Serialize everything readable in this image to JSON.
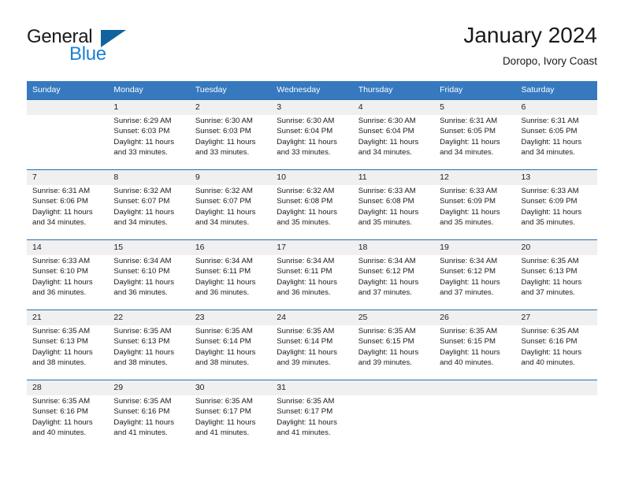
{
  "brand": {
    "name_part1": "General",
    "name_part2": "Blue",
    "flag_icon": "triangle-flag-icon"
  },
  "header": {
    "title": "January 2024",
    "subtitle": "Doropo, Ivory Coast"
  },
  "colors": {
    "header_blue": "#3679bf",
    "row_divider_blue": "#2c6ca8",
    "day_band_gray": "#f0f0f0",
    "brand_blue": "#1c7fd4",
    "flag_blue": "#11639f"
  },
  "weekday_headers": [
    "Sunday",
    "Monday",
    "Tuesday",
    "Wednesday",
    "Thursday",
    "Friday",
    "Saturday"
  ],
  "weeks": [
    {
      "days": [
        {
          "num": "",
          "lines": [
            "",
            "",
            "",
            ""
          ]
        },
        {
          "num": "1",
          "lines": [
            "Sunrise: 6:29 AM",
            "Sunset: 6:03 PM",
            "Daylight: 11 hours",
            "and 33 minutes."
          ]
        },
        {
          "num": "2",
          "lines": [
            "Sunrise: 6:30 AM",
            "Sunset: 6:03 PM",
            "Daylight: 11 hours",
            "and 33 minutes."
          ]
        },
        {
          "num": "3",
          "lines": [
            "Sunrise: 6:30 AM",
            "Sunset: 6:04 PM",
            "Daylight: 11 hours",
            "and 33 minutes."
          ]
        },
        {
          "num": "4",
          "lines": [
            "Sunrise: 6:30 AM",
            "Sunset: 6:04 PM",
            "Daylight: 11 hours",
            "and 34 minutes."
          ]
        },
        {
          "num": "5",
          "lines": [
            "Sunrise: 6:31 AM",
            "Sunset: 6:05 PM",
            "Daylight: 11 hours",
            "and 34 minutes."
          ]
        },
        {
          "num": "6",
          "lines": [
            "Sunrise: 6:31 AM",
            "Sunset: 6:05 PM",
            "Daylight: 11 hours",
            "and 34 minutes."
          ]
        }
      ]
    },
    {
      "days": [
        {
          "num": "7",
          "lines": [
            "Sunrise: 6:31 AM",
            "Sunset: 6:06 PM",
            "Daylight: 11 hours",
            "and 34 minutes."
          ]
        },
        {
          "num": "8",
          "lines": [
            "Sunrise: 6:32 AM",
            "Sunset: 6:07 PM",
            "Daylight: 11 hours",
            "and 34 minutes."
          ]
        },
        {
          "num": "9",
          "lines": [
            "Sunrise: 6:32 AM",
            "Sunset: 6:07 PM",
            "Daylight: 11 hours",
            "and 34 minutes."
          ]
        },
        {
          "num": "10",
          "lines": [
            "Sunrise: 6:32 AM",
            "Sunset: 6:08 PM",
            "Daylight: 11 hours",
            "and 35 minutes."
          ]
        },
        {
          "num": "11",
          "lines": [
            "Sunrise: 6:33 AM",
            "Sunset: 6:08 PM",
            "Daylight: 11 hours",
            "and 35 minutes."
          ]
        },
        {
          "num": "12",
          "lines": [
            "Sunrise: 6:33 AM",
            "Sunset: 6:09 PM",
            "Daylight: 11 hours",
            "and 35 minutes."
          ]
        },
        {
          "num": "13",
          "lines": [
            "Sunrise: 6:33 AM",
            "Sunset: 6:09 PM",
            "Daylight: 11 hours",
            "and 35 minutes."
          ]
        }
      ]
    },
    {
      "days": [
        {
          "num": "14",
          "lines": [
            "Sunrise: 6:33 AM",
            "Sunset: 6:10 PM",
            "Daylight: 11 hours",
            "and 36 minutes."
          ]
        },
        {
          "num": "15",
          "lines": [
            "Sunrise: 6:34 AM",
            "Sunset: 6:10 PM",
            "Daylight: 11 hours",
            "and 36 minutes."
          ]
        },
        {
          "num": "16",
          "lines": [
            "Sunrise: 6:34 AM",
            "Sunset: 6:11 PM",
            "Daylight: 11 hours",
            "and 36 minutes."
          ]
        },
        {
          "num": "17",
          "lines": [
            "Sunrise: 6:34 AM",
            "Sunset: 6:11 PM",
            "Daylight: 11 hours",
            "and 36 minutes."
          ]
        },
        {
          "num": "18",
          "lines": [
            "Sunrise: 6:34 AM",
            "Sunset: 6:12 PM",
            "Daylight: 11 hours",
            "and 37 minutes."
          ]
        },
        {
          "num": "19",
          "lines": [
            "Sunrise: 6:34 AM",
            "Sunset: 6:12 PM",
            "Daylight: 11 hours",
            "and 37 minutes."
          ]
        },
        {
          "num": "20",
          "lines": [
            "Sunrise: 6:35 AM",
            "Sunset: 6:13 PM",
            "Daylight: 11 hours",
            "and 37 minutes."
          ]
        }
      ]
    },
    {
      "days": [
        {
          "num": "21",
          "lines": [
            "Sunrise: 6:35 AM",
            "Sunset: 6:13 PM",
            "Daylight: 11 hours",
            "and 38 minutes."
          ]
        },
        {
          "num": "22",
          "lines": [
            "Sunrise: 6:35 AM",
            "Sunset: 6:13 PM",
            "Daylight: 11 hours",
            "and 38 minutes."
          ]
        },
        {
          "num": "23",
          "lines": [
            "Sunrise: 6:35 AM",
            "Sunset: 6:14 PM",
            "Daylight: 11 hours",
            "and 38 minutes."
          ]
        },
        {
          "num": "24",
          "lines": [
            "Sunrise: 6:35 AM",
            "Sunset: 6:14 PM",
            "Daylight: 11 hours",
            "and 39 minutes."
          ]
        },
        {
          "num": "25",
          "lines": [
            "Sunrise: 6:35 AM",
            "Sunset: 6:15 PM",
            "Daylight: 11 hours",
            "and 39 minutes."
          ]
        },
        {
          "num": "26",
          "lines": [
            "Sunrise: 6:35 AM",
            "Sunset: 6:15 PM",
            "Daylight: 11 hours",
            "and 40 minutes."
          ]
        },
        {
          "num": "27",
          "lines": [
            "Sunrise: 6:35 AM",
            "Sunset: 6:16 PM",
            "Daylight: 11 hours",
            "and 40 minutes."
          ]
        }
      ]
    },
    {
      "days": [
        {
          "num": "28",
          "lines": [
            "Sunrise: 6:35 AM",
            "Sunset: 6:16 PM",
            "Daylight: 11 hours",
            "and 40 minutes."
          ]
        },
        {
          "num": "29",
          "lines": [
            "Sunrise: 6:35 AM",
            "Sunset: 6:16 PM",
            "Daylight: 11 hours",
            "and 41 minutes."
          ]
        },
        {
          "num": "30",
          "lines": [
            "Sunrise: 6:35 AM",
            "Sunset: 6:17 PM",
            "Daylight: 11 hours",
            "and 41 minutes."
          ]
        },
        {
          "num": "31",
          "lines": [
            "Sunrise: 6:35 AM",
            "Sunset: 6:17 PM",
            "Daylight: 11 hours",
            "and 41 minutes."
          ]
        },
        {
          "num": "",
          "lines": [
            "",
            "",
            "",
            ""
          ]
        },
        {
          "num": "",
          "lines": [
            "",
            "",
            "",
            ""
          ]
        },
        {
          "num": "",
          "lines": [
            "",
            "",
            "",
            ""
          ]
        }
      ]
    }
  ]
}
